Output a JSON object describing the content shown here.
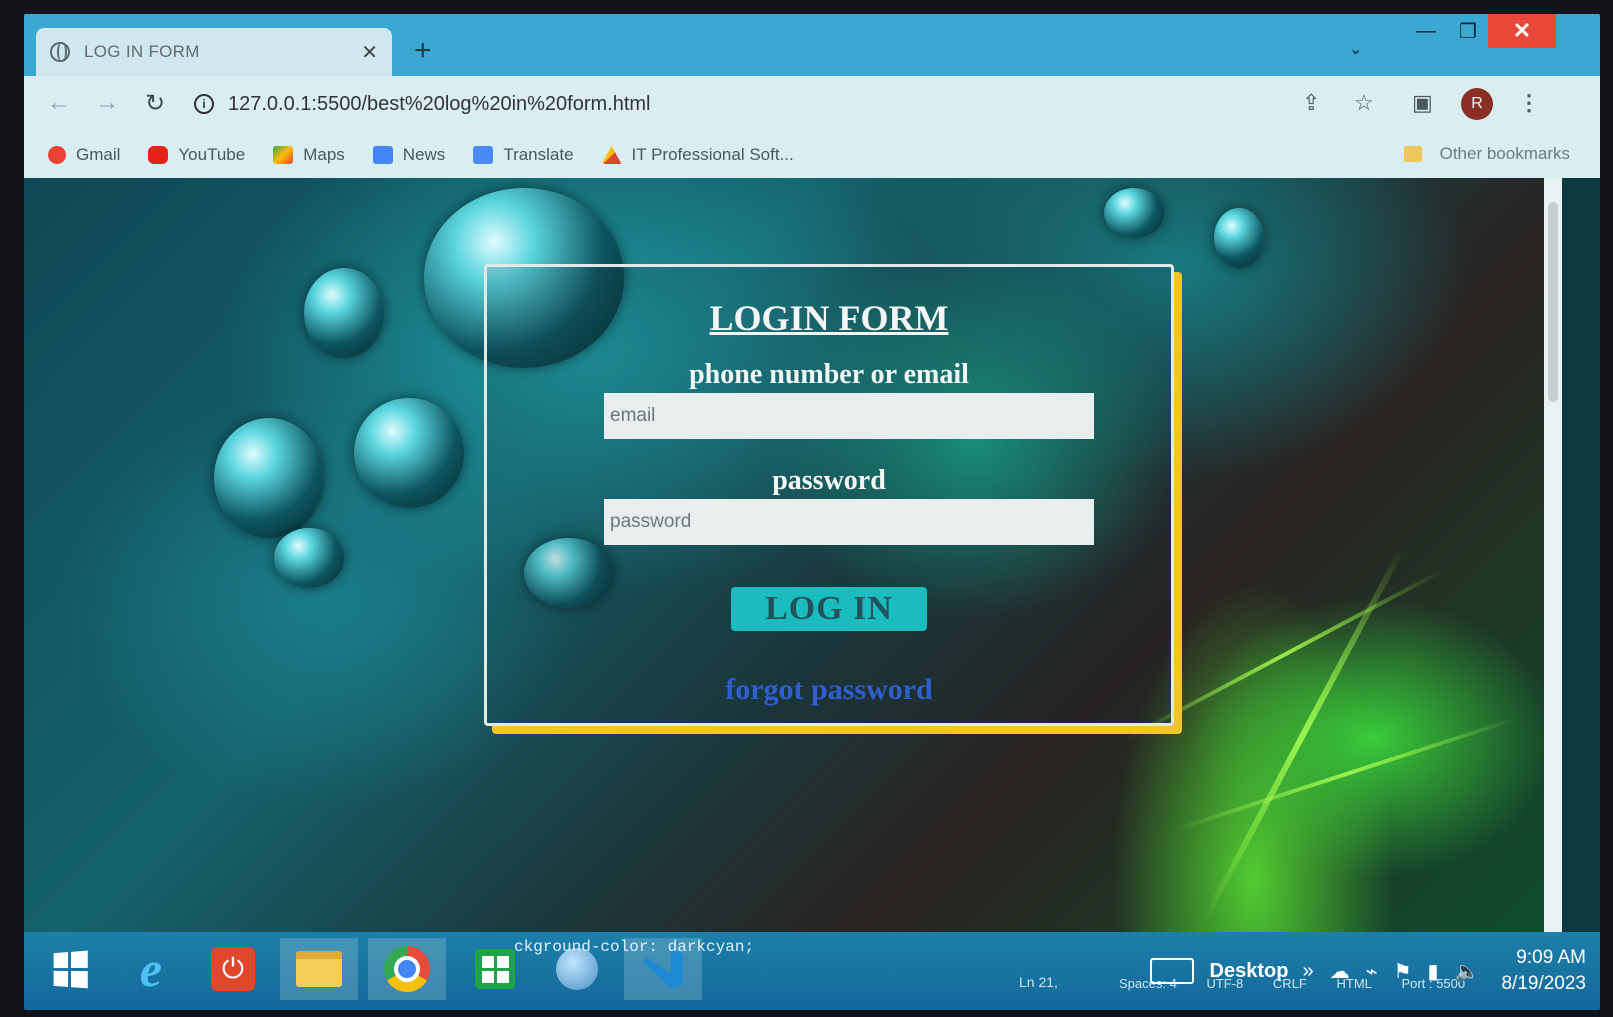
{
  "tab": {
    "title": "LOG IN FORM",
    "close_glyph": "✕",
    "new_glyph": "+"
  },
  "window": {
    "menu_glyph": "⌄",
    "min_glyph": "—",
    "max_glyph": "❐",
    "close_glyph": "✕"
  },
  "toolbar": {
    "back_glyph": "←",
    "forward_glyph": "→",
    "reload_glyph": "↻",
    "url": "127.0.0.1:5500/best%20log%20in%20form.html",
    "info_glyph": "i",
    "share_glyph": "⇪",
    "star_glyph": "☆",
    "side_glyph": "▣",
    "avatar_letter": "R",
    "menu_glyph": "⋮"
  },
  "bookmarks": {
    "items": [
      {
        "label": "Gmail",
        "icon": "gmail-icon",
        "color": "#ea4335"
      },
      {
        "label": "YouTube",
        "icon": "youtube-icon",
        "color": "#e62117"
      },
      {
        "label": "Maps",
        "icon": "maps-icon",
        "color": "#34a853"
      },
      {
        "label": "News",
        "icon": "news-icon",
        "color": "#4285f4"
      },
      {
        "label": "Translate",
        "icon": "translate-icon",
        "color": "#4a8af4"
      },
      {
        "label": "IT Professional Soft...",
        "icon": "it-icon",
        "color": "#d9482b"
      }
    ],
    "other": "Other bookmarks"
  },
  "login": {
    "title": "LOGIN FORM",
    "user_label": "phone number or email",
    "user_placeholder": "email",
    "pass_label": "password",
    "pass_placeholder": "password",
    "button": "LOG IN",
    "forgot": "forgot password"
  },
  "taskbar": {
    "code_overlay": "ckground-color: darkcyan;",
    "ln_col": "Ln 21,",
    "desktop": "Desktop",
    "spaces": "Spaces: 4",
    "encoding": "UTF-8",
    "eol": "CRLF",
    "lang": "HTML",
    "port": "Port : 5500",
    "time": "9:09 AM",
    "date": "8/19/2023"
  },
  "colors": {
    "accent": "#1abcc0",
    "form_shadow": "#f2c42a",
    "link": "#2f5fcf",
    "close": "#e8473a"
  }
}
